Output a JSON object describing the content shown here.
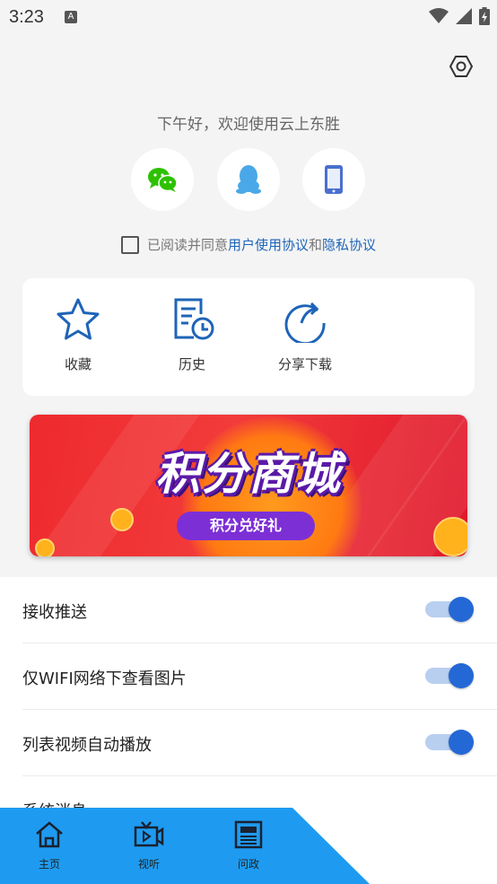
{
  "status_bar": {
    "time": "3:23",
    "notification_icon": "A"
  },
  "greeting": "下午好，欢迎使用云上东胜",
  "login": [
    {
      "name": "wechat-login",
      "icon": "wechat-icon",
      "color": "#2dc100"
    },
    {
      "name": "qq-login",
      "icon": "qq-icon",
      "color": "#4aa8e8"
    },
    {
      "name": "phone-login",
      "icon": "phone-icon",
      "color": "#4a6fcf"
    }
  ],
  "agreement": {
    "prefix": "已阅读并同意",
    "user_agreement": "用户使用协议",
    "and": "和",
    "privacy": "隐私协议"
  },
  "quick_actions": [
    {
      "label": "收藏",
      "icon": "star-icon"
    },
    {
      "label": "历史",
      "icon": "history-icon"
    },
    {
      "label": "分享下载",
      "icon": "share-icon"
    }
  ],
  "banner": {
    "title": "积分商城",
    "subtitle": "积分兑好礼"
  },
  "settings": [
    {
      "label": "接收推送",
      "on": true
    },
    {
      "label": "仅WIFI网络下查看图片",
      "on": true
    },
    {
      "label": "列表视频自动播放",
      "on": true
    },
    {
      "label": "系统消息"
    }
  ],
  "tabbar": [
    {
      "label": "主页",
      "icon": "home-icon"
    },
    {
      "label": "视听",
      "icon": "tv-icon"
    },
    {
      "label": "问政",
      "icon": "newspaper-icon"
    }
  ],
  "colors": {
    "accent": "#2468d6",
    "link": "#1e64b8",
    "tabbar": "#1e9bf0"
  }
}
